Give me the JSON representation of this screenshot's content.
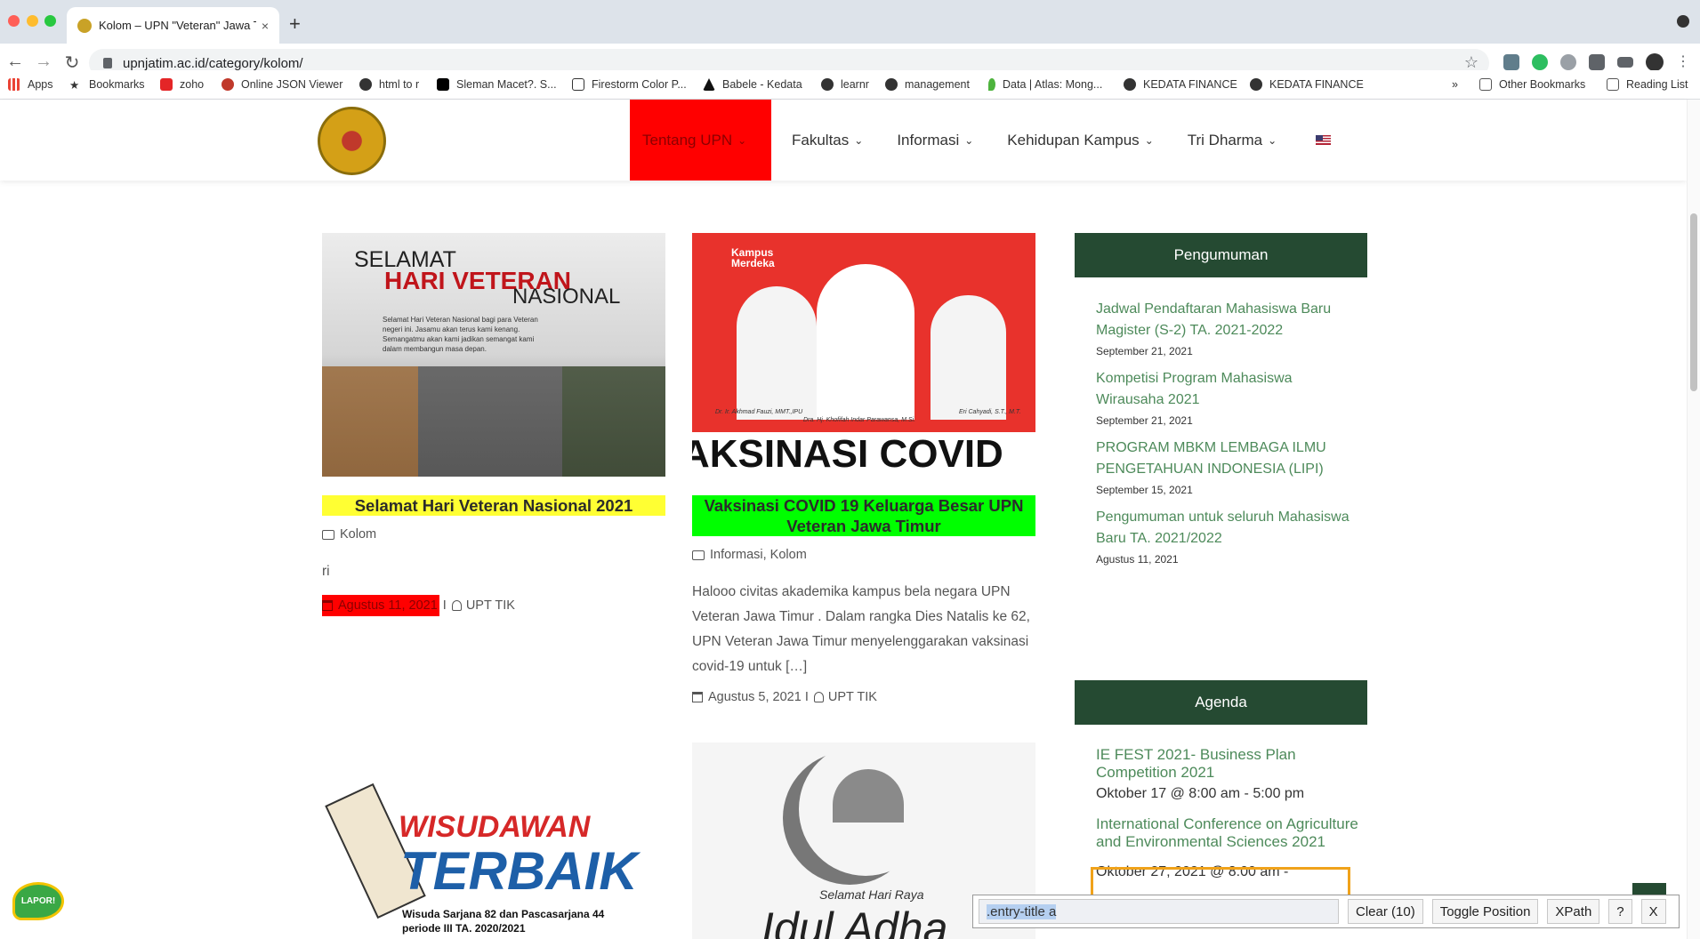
{
  "browser": {
    "tab_title": "Kolom – UPN \"Veteran\" Jawa T",
    "tab_close": "×",
    "new_tab": "+",
    "url": "upnjatim.ac.id/category/kolom/",
    "bookmarks": [
      "Apps",
      "Bookmarks",
      "zoho",
      "Online JSON Viewer",
      "html to r",
      "Sleman Macet?. S...",
      "Firestorm Color P...",
      "Babele - Kedata",
      "learnr",
      "management",
      "Data | Atlas: Mong...",
      "KEDATA FINANCE",
      "KEDATA FINANCE"
    ],
    "bookmarks_more": "»",
    "other_bookmarks": "Other Bookmarks",
    "reading_list": "Reading List"
  },
  "site": {
    "menu": [
      "Tentang UPN",
      "Fakultas",
      "Informasi",
      "Kehidupan Kampus",
      "Tri Dharma"
    ],
    "caret": "⌄"
  },
  "posts": [
    {
      "image_text": [
        "SELAMAT",
        "HARI VETERAN",
        "NASIONAL",
        "Selamat Hari Veteran Nasional bagi para Veteran negeri ini. Jasamu akan terus kami kenang. Semangatmu akan kami jadikan semangat kami dalam membangun masa depan."
      ],
      "title": "Selamat Hari Veteran Nasional 2021",
      "category": "Kolom",
      "excerpt": "ri",
      "date": "Agustus 11, 2021",
      "author": "UPT TIK",
      "sep": "I"
    },
    {
      "image_text": [
        "Kampus Merdeka",
        "Dr. Ir. Akhmad Fauzi, MMT.,IPU",
        "Dra. Hj. Khofifah Indar Parawansa, M.Si.",
        "Eri Cahyadi, S.T., M.T.",
        "AKSINASI COVID"
      ],
      "title": "Vaksinasi COVID 19 Keluarga Besar UPN Veteran Jawa Timur",
      "category": "Informasi, Kolom",
      "excerpt": "Halooo civitas akademika kampus bela negara UPN Veteran Jawa Timur . Dalam rangka Dies Natalis ke 62, UPN Veteran Jawa Timur menyelenggarakan vaksinasi covid-19 untuk […]",
      "date": "Agustus 5, 2021",
      "author": "UPT TIK",
      "sep": "I"
    },
    {
      "image_text": [
        "WISUDAWAN",
        "TERBAIK",
        "Wisuda Sarjana 82 dan Pascasarjana 44",
        "periode III TA. 2020/2021"
      ]
    },
    {
      "image_text": [
        "Selamat Hari Raya",
        "Idul Adha"
      ]
    }
  ],
  "pengumuman": {
    "heading": "Pengumuman",
    "items": [
      {
        "title": "Jadwal Pendaftaran Mahasiswa Baru Magister (S-2) TA. 2021-2022",
        "date": "September 21, 2021"
      },
      {
        "title": "Kompetisi Program Mahasiswa Wirausaha 2021",
        "date": "September 21, 2021"
      },
      {
        "title": "PROGRAM MBKM LEMBAGA ILMU PENGETAHUAN INDONESIA (LIPI)",
        "date": "September 15, 2021"
      },
      {
        "title": "Pengumuman untuk seluruh Mahasiswa Baru TA. 2021/2022",
        "date": "Agustus 11, 2021"
      }
    ]
  },
  "agenda": {
    "heading": "Agenda",
    "items": [
      {
        "title": "IE FEST 2021- Business Plan Competition 2021",
        "time": "Oktober 17 @ 8:00 am - 5:00 pm"
      },
      {
        "title": "International Conference on Agriculture and Environmental Sciences 2021",
        "time": "Oktober 27, 2021 @ 8:00 am -"
      }
    ]
  },
  "xpath_tool": {
    "query": ".entry-title a",
    "clear_label": "Clear (10)",
    "toggle_label": "Toggle Position",
    "xpath_label": "XPath",
    "help_label": "?",
    "close_label": "X"
  },
  "lapor_label": "LAPOR!",
  "colors": {
    "header_green": "#254a32",
    "link_green": "#4d8a5a",
    "highlight_yellow": "#ffff33",
    "highlight_green": "#00ff00",
    "highlight_red": "#ff0000"
  }
}
